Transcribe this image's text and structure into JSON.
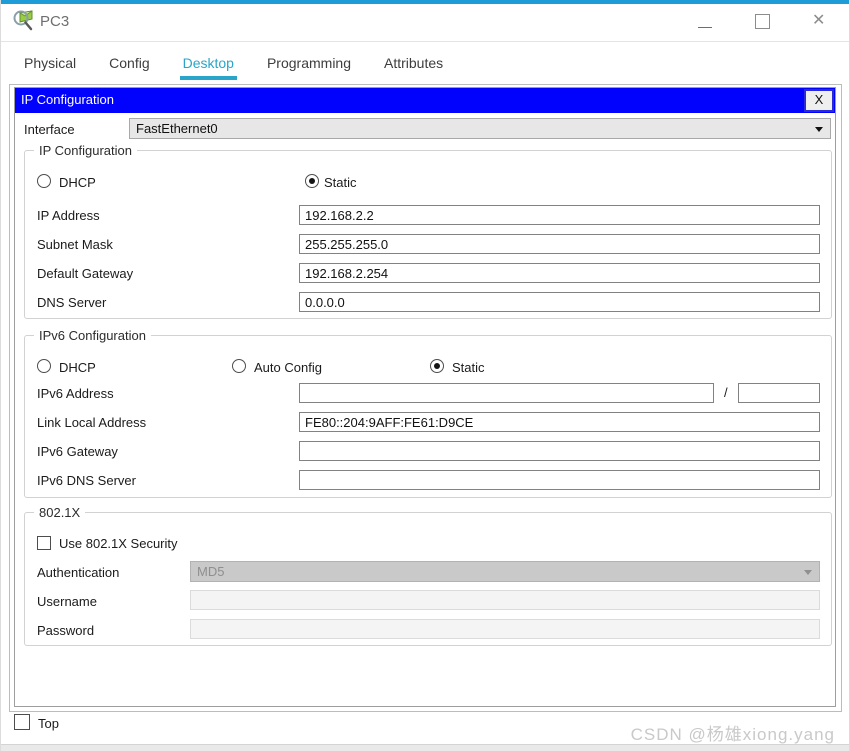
{
  "window": {
    "title": "PC3",
    "app_icon": "packet-tracer-magnifier-icon",
    "close_glyph": "✕"
  },
  "tabs": [
    {
      "label": "Physical",
      "active": false
    },
    {
      "label": "Config",
      "active": false
    },
    {
      "label": "Desktop",
      "active": true
    },
    {
      "label": "Programming",
      "active": false
    },
    {
      "label": "Attributes",
      "active": false
    }
  ],
  "dialog": {
    "title": "IP Configuration",
    "close_label": "X",
    "interface_row": {
      "label": "Interface",
      "value": "FastEthernet0"
    },
    "ipv4": {
      "legend": "IP Configuration",
      "radios": [
        {
          "label": "DHCP",
          "selected": false
        },
        {
          "label": "Static",
          "selected": true
        }
      ],
      "fields": [
        {
          "label": "IP Address",
          "value": "192.168.2.2"
        },
        {
          "label": "Subnet Mask",
          "value": "255.255.255.0"
        },
        {
          "label": "Default Gateway",
          "value": "192.168.2.254"
        },
        {
          "label": "DNS Server",
          "value": "0.0.0.0"
        }
      ]
    },
    "ipv6": {
      "legend": "IPv6 Configuration",
      "radios": [
        {
          "label": "DHCP",
          "selected": false
        },
        {
          "label": "Auto Config",
          "selected": false
        },
        {
          "label": "Static",
          "selected": true
        }
      ],
      "address": {
        "label": "IPv6 Address",
        "value": "",
        "separator": "/",
        "prefix": ""
      },
      "fields": [
        {
          "label": "Link Local Address",
          "value": "FE80::204:9AFF:FE61:D9CE"
        },
        {
          "label": "IPv6 Gateway",
          "value": ""
        },
        {
          "label": "IPv6 DNS Server",
          "value": ""
        }
      ]
    },
    "dot1x": {
      "legend": "802.1X",
      "security_checkbox": {
        "label": "Use 802.1X Security",
        "checked": false
      },
      "authentication": {
        "label": "Authentication",
        "value": "MD5",
        "enabled": false
      },
      "username": {
        "label": "Username",
        "value": "",
        "enabled": false
      },
      "password": {
        "label": "Password",
        "value": "",
        "enabled": false
      }
    }
  },
  "footer": {
    "top_checkbox": {
      "label": "Top",
      "checked": false
    },
    "watermark": "CSDN @杨雄xiong.yang"
  },
  "colors": {
    "accent_teal": "#2AA5C9",
    "window_top_border": "#1E9CD8",
    "dialog_titlebar_blue": "#0101FE",
    "watermark_gray": "#C9C9C9"
  }
}
